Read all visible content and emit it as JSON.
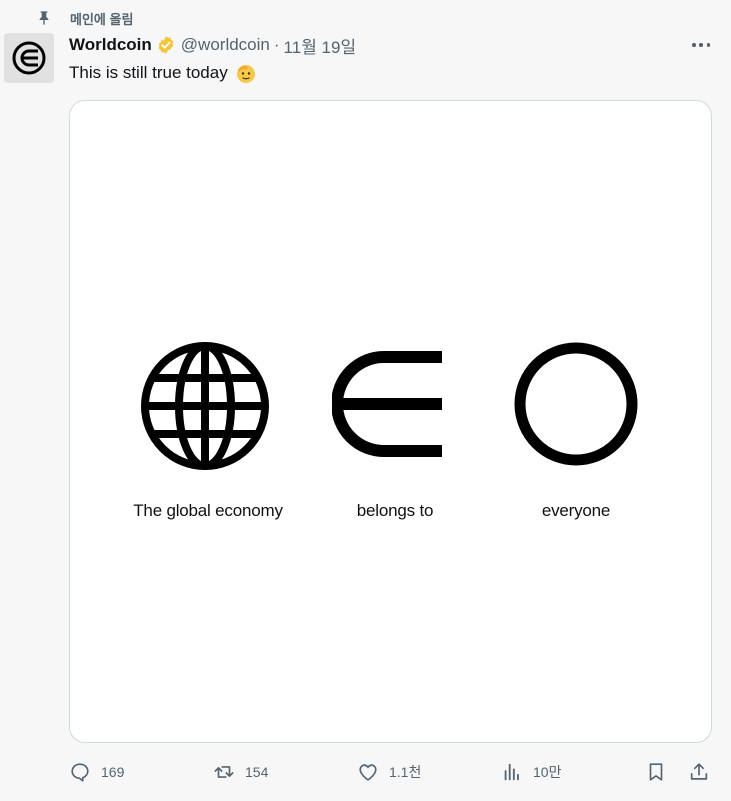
{
  "pinned": {
    "label": "메인에 올림",
    "icon": "pin-icon"
  },
  "author": {
    "name": "Worldcoin",
    "handle": "@worldcoin",
    "separator": "·",
    "timestamp": "11월 19일",
    "verified_color": "#f4c43a"
  },
  "tweet": {
    "text": "This is still true today",
    "emoji": "saluting-face-emoji"
  },
  "media": {
    "captions": [
      "The global economy",
      "belongs to",
      "everyone"
    ]
  },
  "actions": {
    "reply_count": "169",
    "retweet_count": "154",
    "like_count": "1.1천",
    "view_count": "10만"
  },
  "colors": {
    "text": "#0f1419",
    "secondary": "#536471",
    "border": "#cfd9de"
  }
}
